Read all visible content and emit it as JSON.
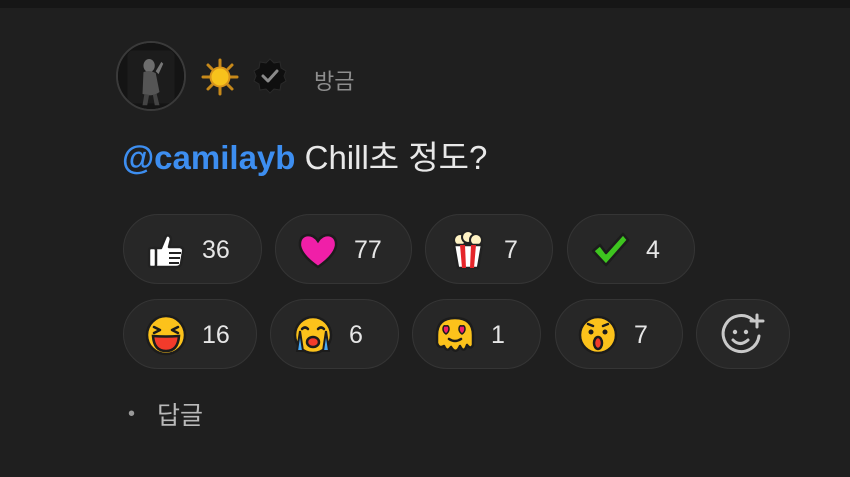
{
  "comment": {
    "timestamp": "방금",
    "mention": "@camilayb",
    "text": " Chill초 정도?"
  },
  "user": {
    "name_emoji_icon": "sun-icon",
    "verified_icon": "verified-badge-icon"
  },
  "reactions": [
    {
      "icon": "thumbs-up-icon",
      "count": "36"
    },
    {
      "icon": "heart-icon",
      "count": "77"
    },
    {
      "icon": "popcorn-icon",
      "count": "7"
    },
    {
      "icon": "checkmark-icon",
      "count": "4"
    },
    {
      "icon": "laughing-face-icon",
      "count": "16"
    },
    {
      "icon": "crying-face-icon",
      "count": "6"
    },
    {
      "icon": "melting-heart-eyes-icon",
      "count": "1"
    },
    {
      "icon": "surprised-face-icon",
      "count": "7"
    }
  ],
  "add_reaction_icon": "add-reaction-icon",
  "reply": {
    "dot": "•",
    "label": "답글"
  }
}
